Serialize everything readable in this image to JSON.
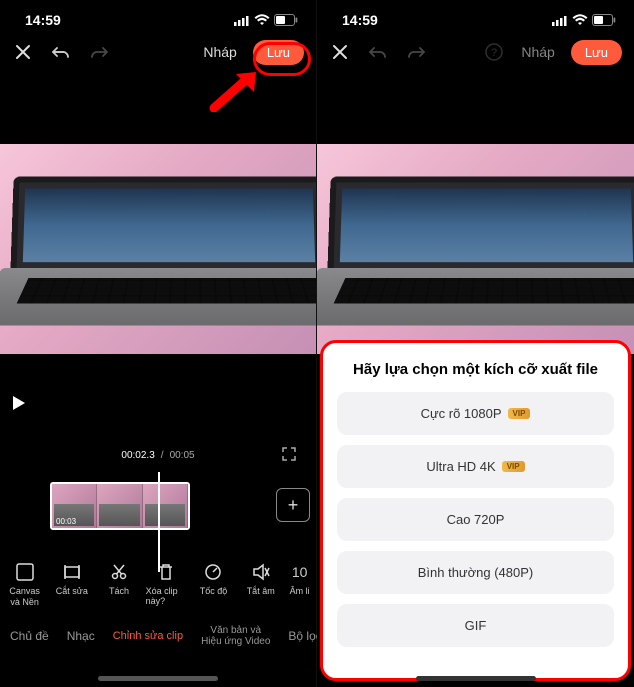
{
  "status": {
    "time": "14:59"
  },
  "topbar": {
    "entry_label": "Nháp",
    "save_label": "Lưu"
  },
  "playback": {
    "current": "00:02.3",
    "total": "00:05"
  },
  "clip": {
    "duration": "00:03"
  },
  "tools": [
    {
      "icon": "⬜",
      "label_line1": "Canvas",
      "label_line2": "và Nền"
    },
    {
      "icon": "✂",
      "label_line1": "Cắt sửa",
      "label_line2": ""
    },
    {
      "icon": "⋔",
      "label_line1": "Tách",
      "label_line2": ""
    },
    {
      "icon": "🗑",
      "label_line1": "Xóa clip này?",
      "label_line2": ""
    },
    {
      "icon": "⏱",
      "label_line1": "Tốc độ",
      "label_line2": ""
    },
    {
      "icon": "🔇",
      "label_line1": "Tắt âm",
      "label_line2": ""
    },
    {
      "icon": "10",
      "label_line1": "Âm li",
      "label_line2": ""
    }
  ],
  "categories": {
    "tab1": "Chủ đề",
    "tab2": "Nhạc",
    "tab3": "Chỉnh sửa clip",
    "tab4_line1": "Văn bản và",
    "tab4_line2": "Hiệu ứng Video",
    "tab5": "Bộ lọc"
  },
  "modal": {
    "title": "Hãy lựa chọn một kích cỡ xuất file",
    "vip_text": "VIP",
    "options": [
      {
        "label": "Cực rõ 1080P",
        "vip": true
      },
      {
        "label": "Ultra HD 4K",
        "vip": true
      },
      {
        "label": "Cao 720P",
        "vip": false
      },
      {
        "label": "Bình thường (480P)",
        "vip": false
      },
      {
        "label": "GIF",
        "vip": false
      }
    ]
  }
}
